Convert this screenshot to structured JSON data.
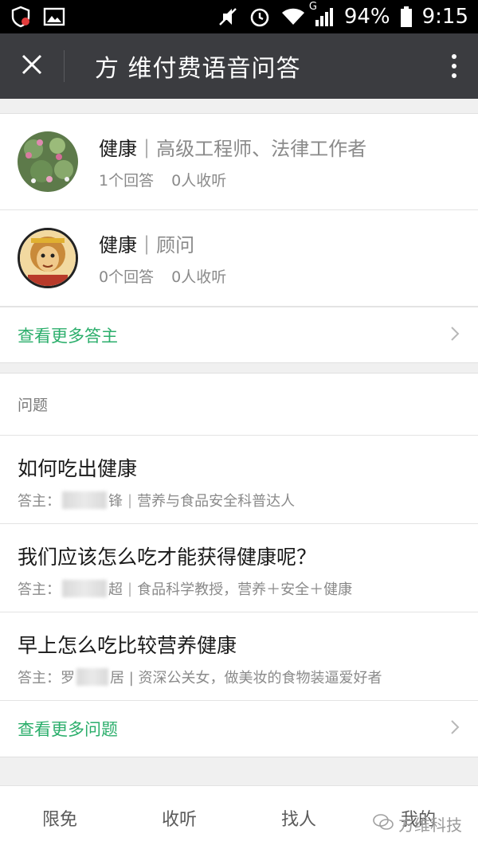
{
  "status_bar": {
    "battery": "94%",
    "time": "9:15",
    "network_type": "G",
    "icons": [
      "shield-app-icon",
      "image-icon",
      "mute-icon",
      "alarm-icon",
      "wifi-icon",
      "signal-icon",
      "battery-icon"
    ]
  },
  "header": {
    "title": "方 维付费语音问答",
    "close_icon": "close-icon",
    "menu_icon": "more-vertical-icon"
  },
  "answerers": [
    {
      "name": "健康",
      "separator": "|",
      "title": "高级工程师、法律工作者",
      "answers": "1个回答",
      "listeners": "0人收听"
    },
    {
      "name": "健康",
      "separator": "|",
      "title": "顾问",
      "answers": "0个回答",
      "listeners": "0人收听"
    }
  ],
  "more_answerers_label": "查看更多答主",
  "questions_header": "问题",
  "questions": [
    {
      "title": "如何吃出健康",
      "prefix": "答主：",
      "name_visible_end": "锋",
      "separator": "|",
      "desc": "营养与食品安全科普达人"
    },
    {
      "title": "我们应该怎么吃才能获得健康呢？",
      "prefix": "答主：",
      "name_visible_end": "超",
      "separator": "|",
      "desc": "食品科学教授，营养＋安全＋健康"
    },
    {
      "title": "早上怎么吃比较营养健康",
      "prefix": "答主：",
      "name_visible_end": "罗",
      "separator": "|",
      "desc": "居 | 资深公关女，做美妆的食物装逼爱好者"
    }
  ],
  "more_questions_label": "查看更多问题",
  "tabs": [
    {
      "label": "限免"
    },
    {
      "label": "收听"
    },
    {
      "label": "找人"
    },
    {
      "label": "我的"
    }
  ],
  "watermark": "方维科技",
  "colors": {
    "accent_green": "#2bae6b",
    "header_bg": "#3b3c40"
  }
}
